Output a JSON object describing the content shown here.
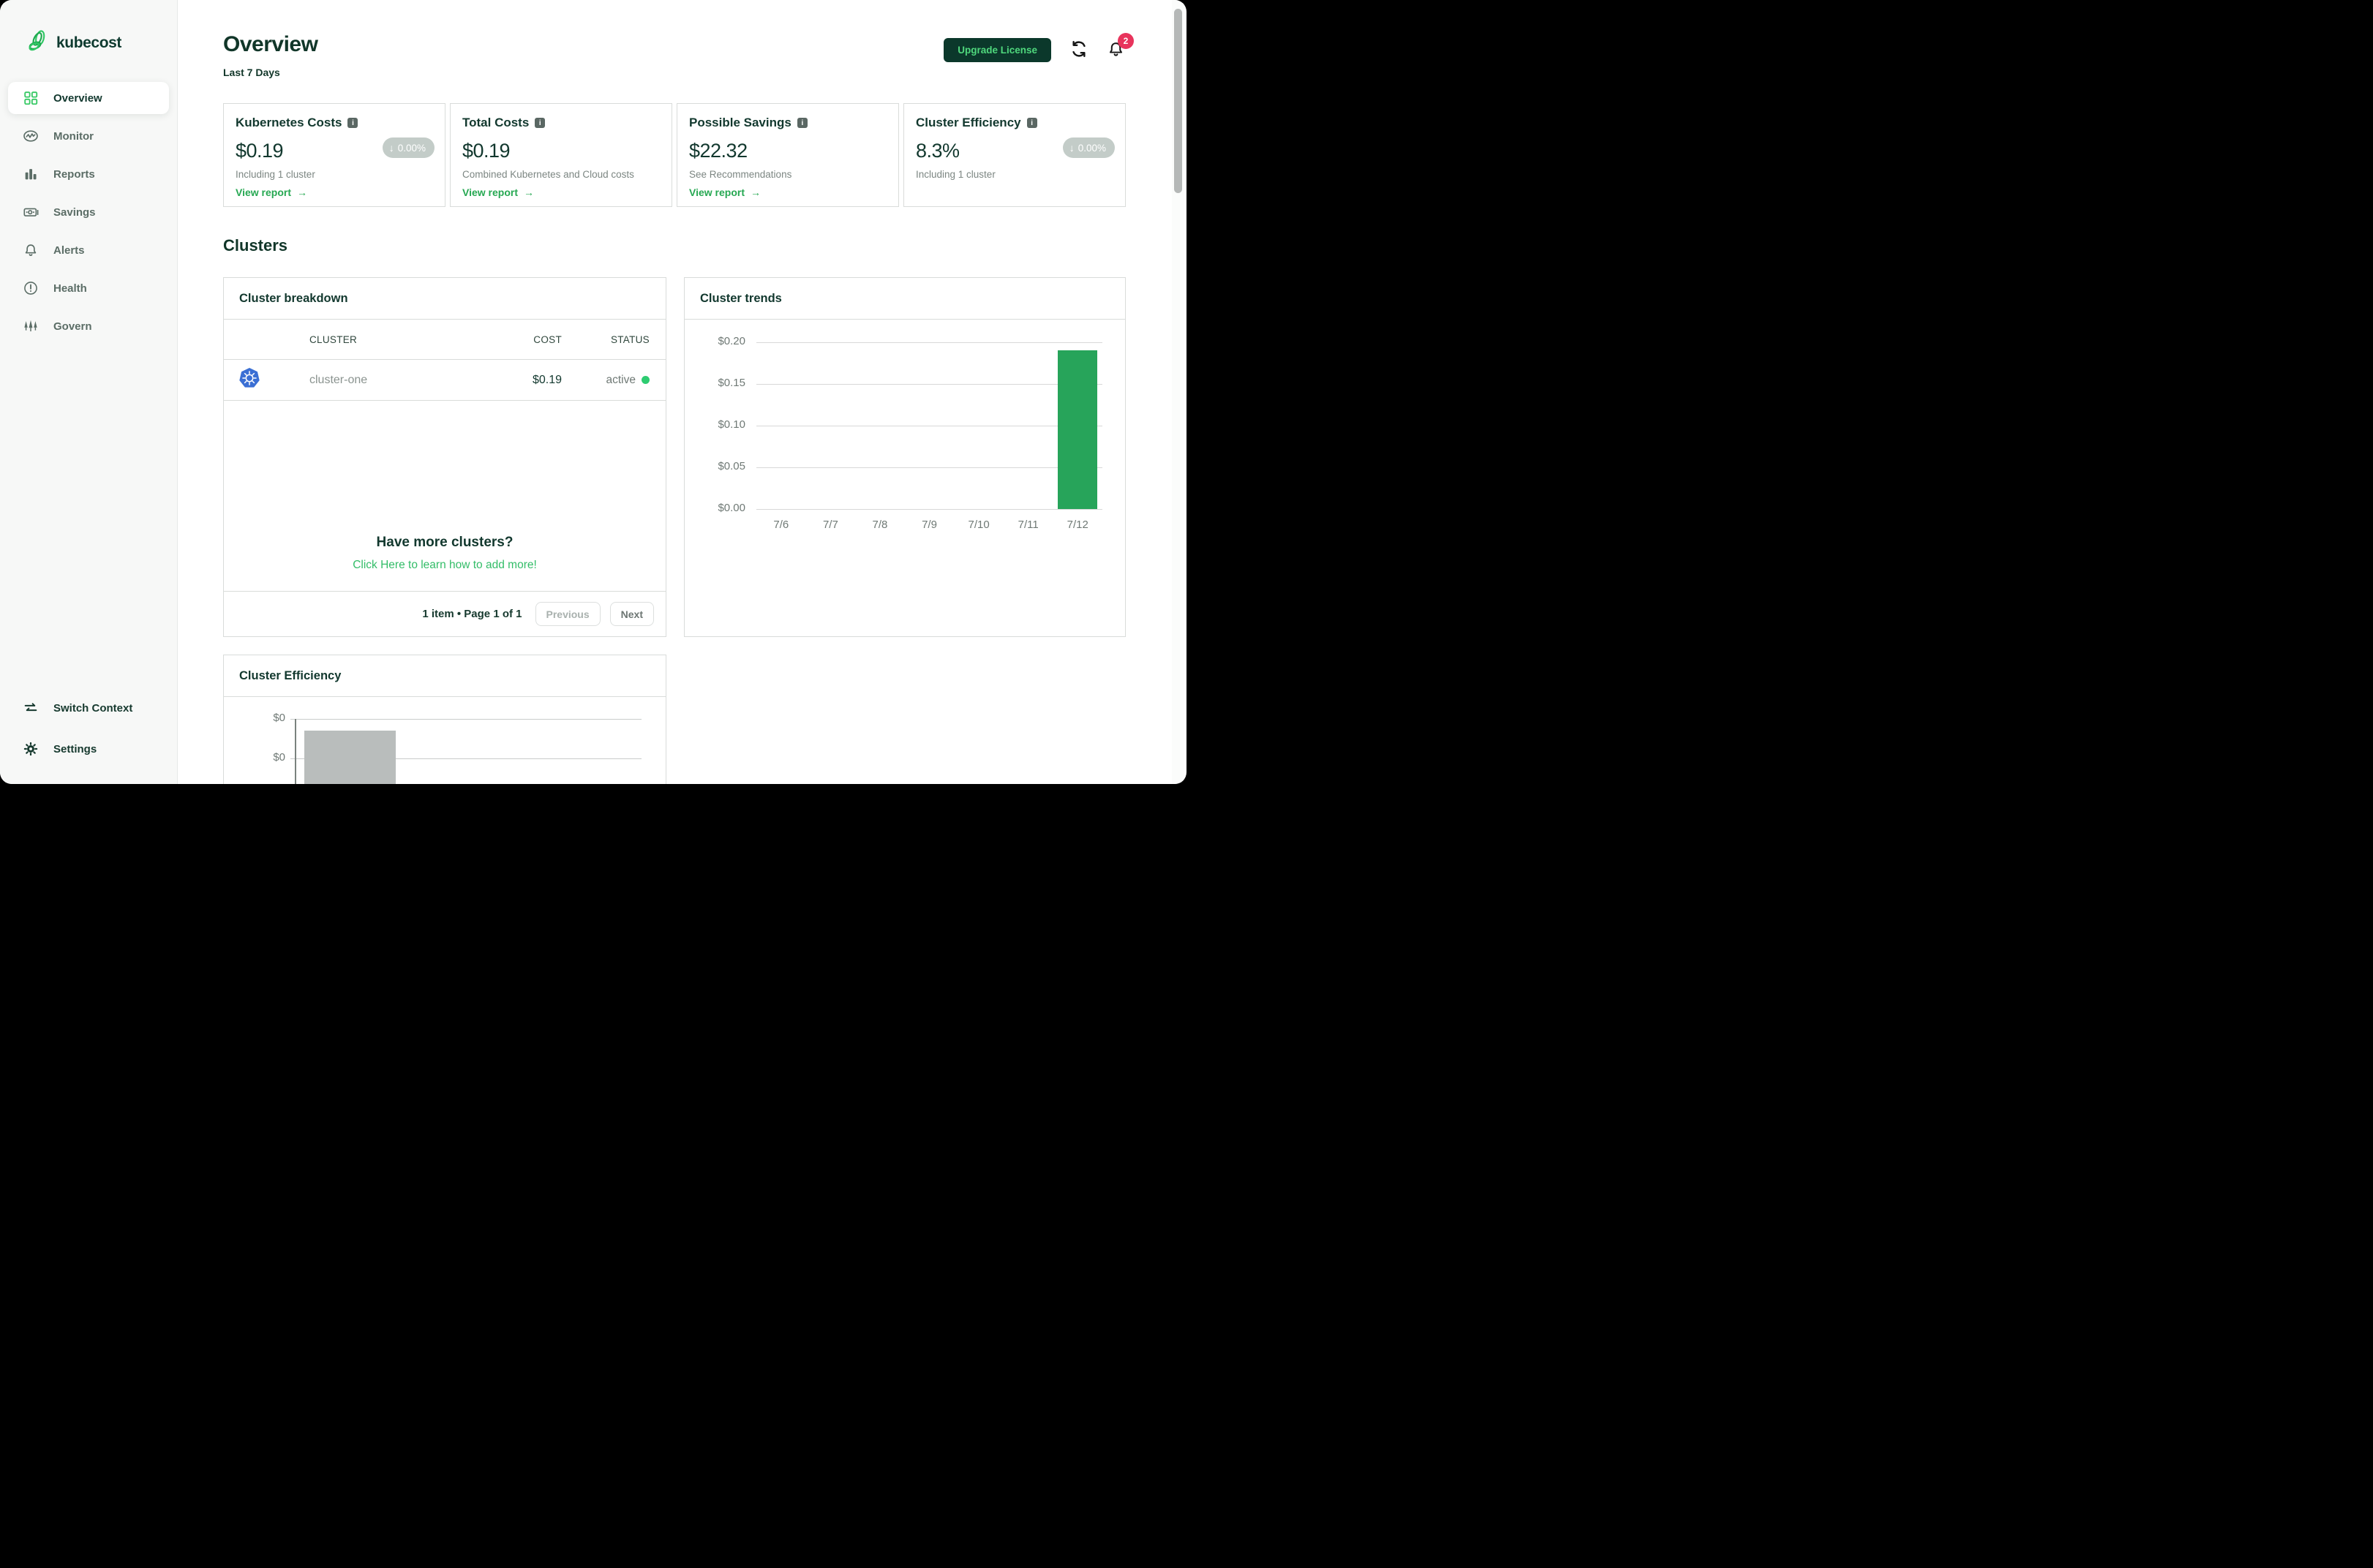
{
  "logo": {
    "text": "kubecost"
  },
  "sidebar": {
    "items": [
      {
        "label": "Overview",
        "icon": "grid-icon",
        "active": true
      },
      {
        "label": "Monitor",
        "icon": "monitor-pulse-icon"
      },
      {
        "label": "Reports",
        "icon": "bar-chart-icon"
      },
      {
        "label": "Savings",
        "icon": "banknote-icon"
      },
      {
        "label": "Alerts",
        "icon": "bell-icon"
      },
      {
        "label": "Health",
        "icon": "alert-circle-icon"
      },
      {
        "label": "Govern",
        "icon": "trees-icon"
      }
    ],
    "footer_items": [
      {
        "label": "Switch Context",
        "icon": "switch-arrows-icon"
      },
      {
        "label": "Settings",
        "icon": "gear-icon"
      }
    ]
  },
  "header": {
    "title": "Overview",
    "subtitle": "Last 7 Days",
    "upgrade_button": "Upgrade License",
    "notification_count": "2"
  },
  "stat_cards": [
    {
      "title": "Kubernetes Costs",
      "value": "$0.19",
      "badge": {
        "direction": "down",
        "label": "0.00%"
      },
      "subtext": "Including 1 cluster",
      "link": "View report"
    },
    {
      "title": "Total Costs",
      "value": "$0.19",
      "subtext": "Combined Kubernetes and Cloud costs",
      "link": "View report"
    },
    {
      "title": "Possible Savings",
      "value": "$22.32",
      "subtext": "See Recommendations",
      "link": "View report"
    },
    {
      "title": "Cluster Efficiency",
      "value": "8.3%",
      "badge": {
        "direction": "down",
        "label": "0.00%"
      },
      "subtext": "Including 1 cluster"
    }
  ],
  "clusters": {
    "heading": "Clusters",
    "breakdown": {
      "title": "Cluster breakdown",
      "columns": [
        "CLUSTER",
        "COST",
        "STATUS"
      ],
      "rows": [
        {
          "cluster": "cluster-one",
          "cost": "$0.19",
          "status": "active",
          "icon": "kubernetes-icon"
        }
      ],
      "promo_title": "Have more clusters?",
      "promo_link": "Click Here to learn how to add more!",
      "pagination": "1 item • Page 1 of 1",
      "previous": "Previous",
      "next": "Next"
    },
    "trends_title": "Cluster trends",
    "efficiency_title": "Cluster Efficiency"
  },
  "chart_data": [
    {
      "type": "bar",
      "title": "Cluster trends",
      "categories": [
        "7/6",
        "7/7",
        "7/8",
        "7/9",
        "7/10",
        "7/11",
        "7/12"
      ],
      "values": [
        0,
        0,
        0,
        0,
        0,
        0,
        0.19
      ],
      "yticks": [
        "$0.20",
        "$0.15",
        "$0.10",
        "$0.05",
        "$0.00"
      ],
      "ylim": [
        0,
        0.2
      ],
      "grid": true,
      "legend": false,
      "bar_color": "#27a45a"
    },
    {
      "type": "bar",
      "title": "Cluster Efficiency",
      "yticks_visible": [
        "$0",
        "$0"
      ],
      "bar_color": "#b9bdbc",
      "truncated": true
    }
  ],
  "colors": {
    "accent_green": "#2fc763",
    "dark_green": "#12382e",
    "link_green": "#26a852",
    "upgrade_bg": "#0b382b",
    "upgrade_text": "#4fd87d",
    "badge_pill": "#c3ccc8",
    "notification_red": "#e8345c",
    "status_dot": "#2ecc71",
    "kubernetes_blue": "#3b6fd4",
    "bar_green": "#27a45a",
    "bar_gray": "#b9bdbc"
  }
}
